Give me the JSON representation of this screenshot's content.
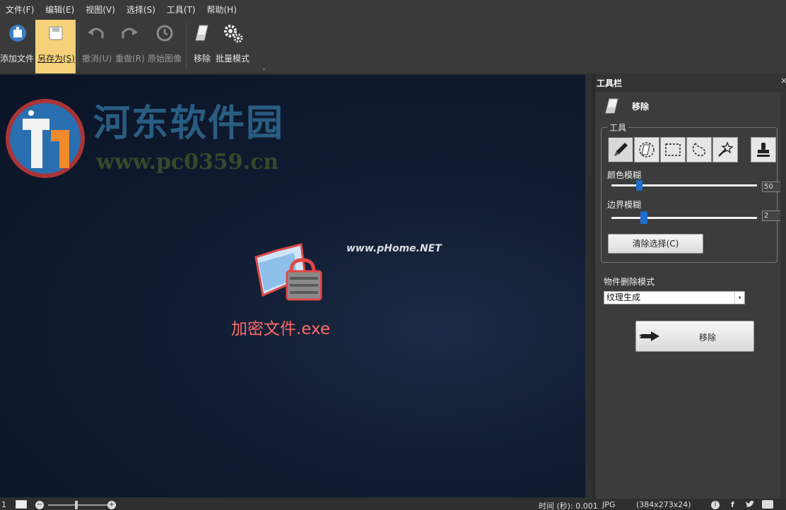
{
  "menu": [
    "文件(F)",
    "编辑(E)",
    "视图(V)",
    "选择(S)",
    "工具(T)",
    "帮助(H)"
  ],
  "toolbar": {
    "add_file": "添加文件",
    "save_as": "另存为(S)",
    "undo": "撤消(U)",
    "redo": "重做(R)",
    "original": "原始图像",
    "remove": "移除",
    "batch": "批量模式",
    "more": "⌄"
  },
  "canvas": {
    "watermark_site": "河东软件园",
    "watermark_url": "www.pc0359.cn",
    "phome": "www.pHome.NET",
    "file_name": "加密文件.exe"
  },
  "panel": {
    "title": "工具栏",
    "close": "×",
    "tool_heading": "移除",
    "tools_group": "工具",
    "color_blur_label": "颜色模糊",
    "color_blur_value": "50",
    "color_blur_level": 0.17,
    "edge_blur_label": "边界模糊",
    "edge_blur_value": "2",
    "edge_blur_level": 0.2,
    "clear_selection": "清除选择(C)",
    "delete_mode_label": "物件删除模式",
    "delete_mode_value": "纹理生成",
    "remove_button": "移除"
  },
  "statusbar": {
    "left_num": "1",
    "zoom_minus": "−",
    "zoom_plus": "+",
    "time": "时间 (秒): 0.001",
    "format": "JPG",
    "dimensions": "(384x273x24)"
  },
  "colors": {
    "accent": "#1c6fd0",
    "active_button": "#f5d27a",
    "file_name": "#ff6a6a"
  }
}
